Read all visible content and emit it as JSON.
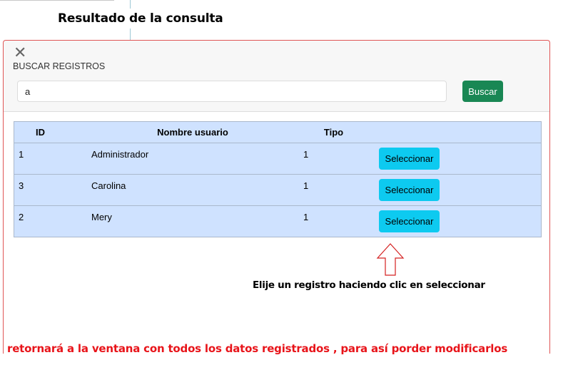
{
  "heading": "Resultado de la consulta",
  "modal": {
    "title": "BUSCAR REGISTROS",
    "search_value": "a",
    "search_button": "Buscar"
  },
  "table": {
    "headers": [
      "ID",
      "Nombre usuario",
      "Tipo"
    ],
    "rows": [
      {
        "id": "1",
        "name": "Administrador",
        "tipo": "1",
        "action": "Seleccionar"
      },
      {
        "id": "3",
        "name": "Carolina",
        "tipo": "1",
        "action": "Seleccionar"
      },
      {
        "id": "2",
        "name": "Mery",
        "tipo": "1",
        "action": "Seleccionar"
      }
    ]
  },
  "annotation": {
    "hint": "Elije un registro haciendo clic en seleccionar",
    "footer": "retornará a la ventana con todos los datos registrados , para así porder modificarlos"
  },
  "icons": {
    "close": "close-icon",
    "arrow": "up-arrow-icon"
  },
  "colors": {
    "search_button": "#198754",
    "select_button": "#0dcaf0",
    "table_background": "#cfe2ff",
    "modal_border": "#e05555",
    "footer_text": "#e8141a"
  }
}
